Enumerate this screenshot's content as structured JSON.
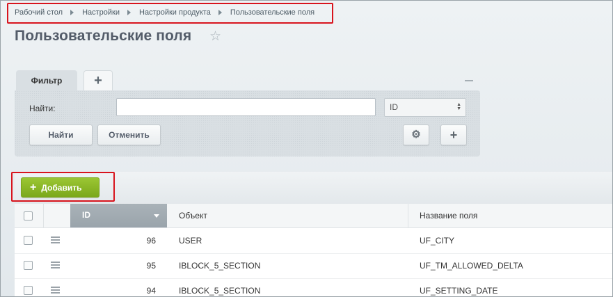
{
  "breadcrumb": [
    "Рабочий стол",
    "Настройки",
    "Настройки продукта",
    "Пользовательские поля"
  ],
  "page_title": "Пользовательские поля",
  "filter": {
    "tab_label": "Фильтр",
    "add_tab_label": "+",
    "find_label": "Найти:",
    "find_value": "",
    "select_value": "ID",
    "find_button": "Найти",
    "cancel_button": "Отменить"
  },
  "toolbar": {
    "add_button": "Добавить"
  },
  "grid": {
    "columns": {
      "id": "ID",
      "object": "Объект",
      "field_name": "Название поля"
    },
    "rows": [
      {
        "id": "96",
        "object": "USER",
        "field_name": "UF_CITY"
      },
      {
        "id": "95",
        "object": "IBLOCK_5_SECTION",
        "field_name": "UF_TM_ALLOWED_DELTA"
      },
      {
        "id": "94",
        "object": "IBLOCK_5_SECTION",
        "field_name": "UF_SETTING_DATE"
      }
    ]
  },
  "colors": {
    "accent_green": "#88b629",
    "highlight_red": "#d8141d",
    "sorted_column": "#a1abb1"
  }
}
